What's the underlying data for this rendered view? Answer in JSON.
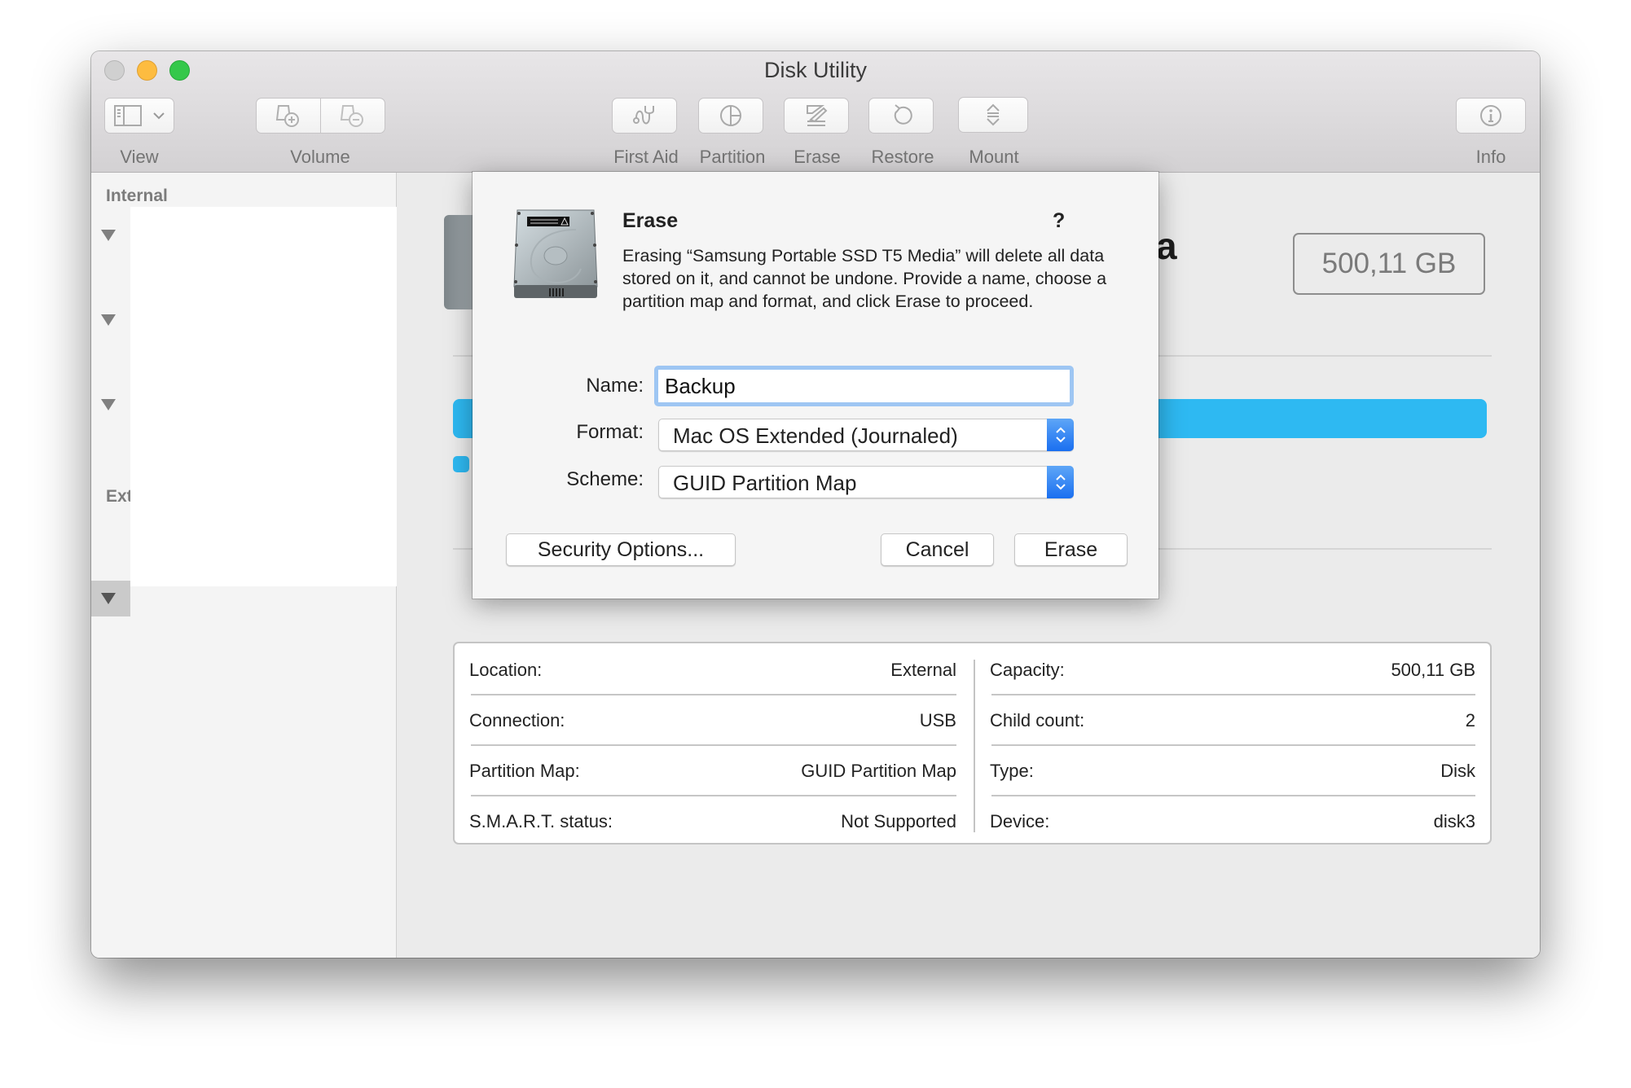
{
  "window": {
    "title": "Disk Utility"
  },
  "toolbar": {
    "view_label": "View",
    "volume_label": "Volume",
    "first_aid_label": "First Aid",
    "partition_label": "Partition",
    "erase_label": "Erase",
    "restore_label": "Restore",
    "mount_label": "Mount",
    "info_label": "Info"
  },
  "sidebar": {
    "internal_header": "Internal",
    "external_header": "Ext"
  },
  "main": {
    "disk_name_visible_tail": "a",
    "capacity_badge": "500,11 GB",
    "usage_color": "#2eb9f2",
    "info_left": [
      {
        "label": "Location:",
        "value": "External"
      },
      {
        "label": "Connection:",
        "value": "USB"
      },
      {
        "label": "Partition Map:",
        "value": "GUID Partition Map"
      },
      {
        "label": "S.M.A.R.T. status:",
        "value": "Not Supported"
      }
    ],
    "info_right": [
      {
        "label": "Capacity:",
        "value": "500,11 GB"
      },
      {
        "label": "Child count:",
        "value": "2"
      },
      {
        "label": "Type:",
        "value": "Disk"
      },
      {
        "label": "Device:",
        "value": "disk3"
      }
    ]
  },
  "dialog": {
    "title": "Erase",
    "help": "?",
    "message": "Erasing “Samsung Portable SSD T5 Media” will delete all data stored on it, and cannot be undone. Provide a name, choose a partition map and format, and click Erase to proceed.",
    "name_label": "Name:",
    "name_value": "Backup",
    "format_label": "Format:",
    "format_value": "Mac OS Extended (Journaled)",
    "scheme_label": "Scheme:",
    "scheme_value": "GUID Partition Map",
    "security_button": "Security Options...",
    "cancel_button": "Cancel",
    "erase_button": "Erase"
  }
}
